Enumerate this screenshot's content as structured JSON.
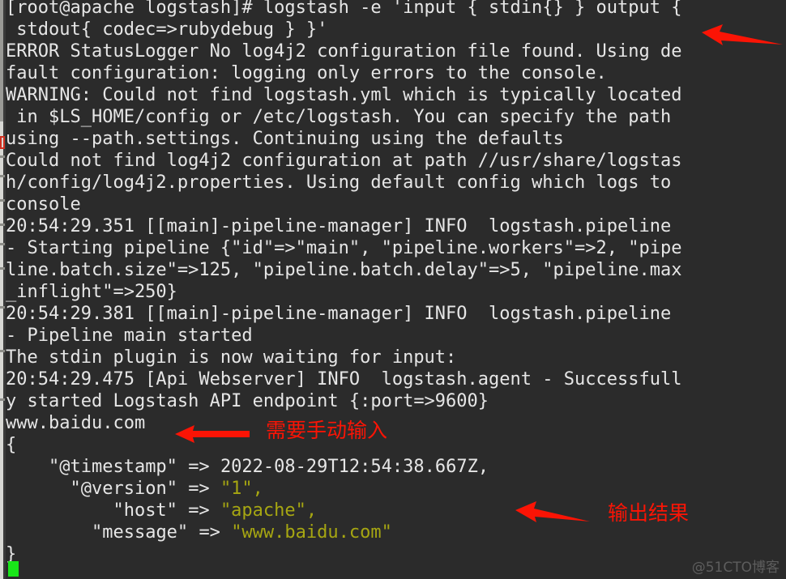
{
  "terminal": {
    "background_color": "#2b2b2b",
    "foreground_color": "#e6e6e6",
    "string_color": "#a6a612",
    "cursor_color": "#19e619",
    "prompt": "[root@apache logstash]#",
    "command": "logstash -e 'input { stdin{} } output { stdout{ codec=>rubydebug } }'",
    "lines": [
      "[root@apache logstash]# logstash -e 'input { stdin{} } output {",
      " stdout{ codec=>rubydebug } }'",
      "ERROR StatusLogger No log4j2 configuration file found. Using de",
      "fault configuration: logging only errors to the console.",
      "WARNING: Could not find logstash.yml which is typically located",
      " in $LS_HOME/config or /etc/logstash. You can specify the path",
      "using --path.settings. Continuing using the defaults",
      "Could not find log4j2 configuration at path //usr/share/logstas",
      "h/config/log4j2.properties. Using default config which logs to",
      "console",
      "20:54:29.351 [[main]-pipeline-manager] INFO  logstash.pipeline",
      "- Starting pipeline {\"id\"=>\"main\", \"pipeline.workers\"=>2, \"pipe",
      "line.batch.size\"=>125, \"pipeline.batch.delay\"=>5, \"pipeline.max",
      "_inflight\"=>250}",
      "20:54:29.381 [[main]-pipeline-manager] INFO  logstash.pipeline",
      "- Pipeline main started",
      "The stdin plugin is now waiting for input:",
      "20:54:29.475 [Api Webserver] INFO  logstash.agent - Successfull",
      "y started Logstash API endpoint {:port=>9600}",
      "www.baidu.com",
      "{",
      "}"
    ],
    "user_input": "www.baidu.com",
    "output_event": {
      "open_brace": "{",
      "close_brace": "}",
      "fields": [
        {
          "key": "\"@timestamp\"",
          "arrow": "=>",
          "value": "2022-08-29T12:54:38.667Z,",
          "value_is_string": false,
          "indent": 4
        },
        {
          "key": "\"@version\"",
          "arrow": "=>",
          "value": "\"1\",",
          "value_is_string": true,
          "indent": 6
        },
        {
          "key": "\"host\"",
          "arrow": "=>",
          "value": "\"apache\",",
          "value_is_string": true,
          "indent": 10
        },
        {
          "key": "\"message\"",
          "arrow": "=>",
          "value": "\"www.baidu.com\"",
          "value_is_string": true,
          "indent": 8
        }
      ]
    }
  },
  "annotations": [
    {
      "name": "command-arrow",
      "text": "",
      "color": "#fb1405"
    },
    {
      "name": "manual-input-note",
      "text": "需要手动输入",
      "color": "#fb1405"
    },
    {
      "name": "output-result-note",
      "text": "输出结果",
      "color": "#fb1405"
    }
  ],
  "watermark": {
    "text": "@51CTO博客",
    "color": "#5d5d5d"
  }
}
